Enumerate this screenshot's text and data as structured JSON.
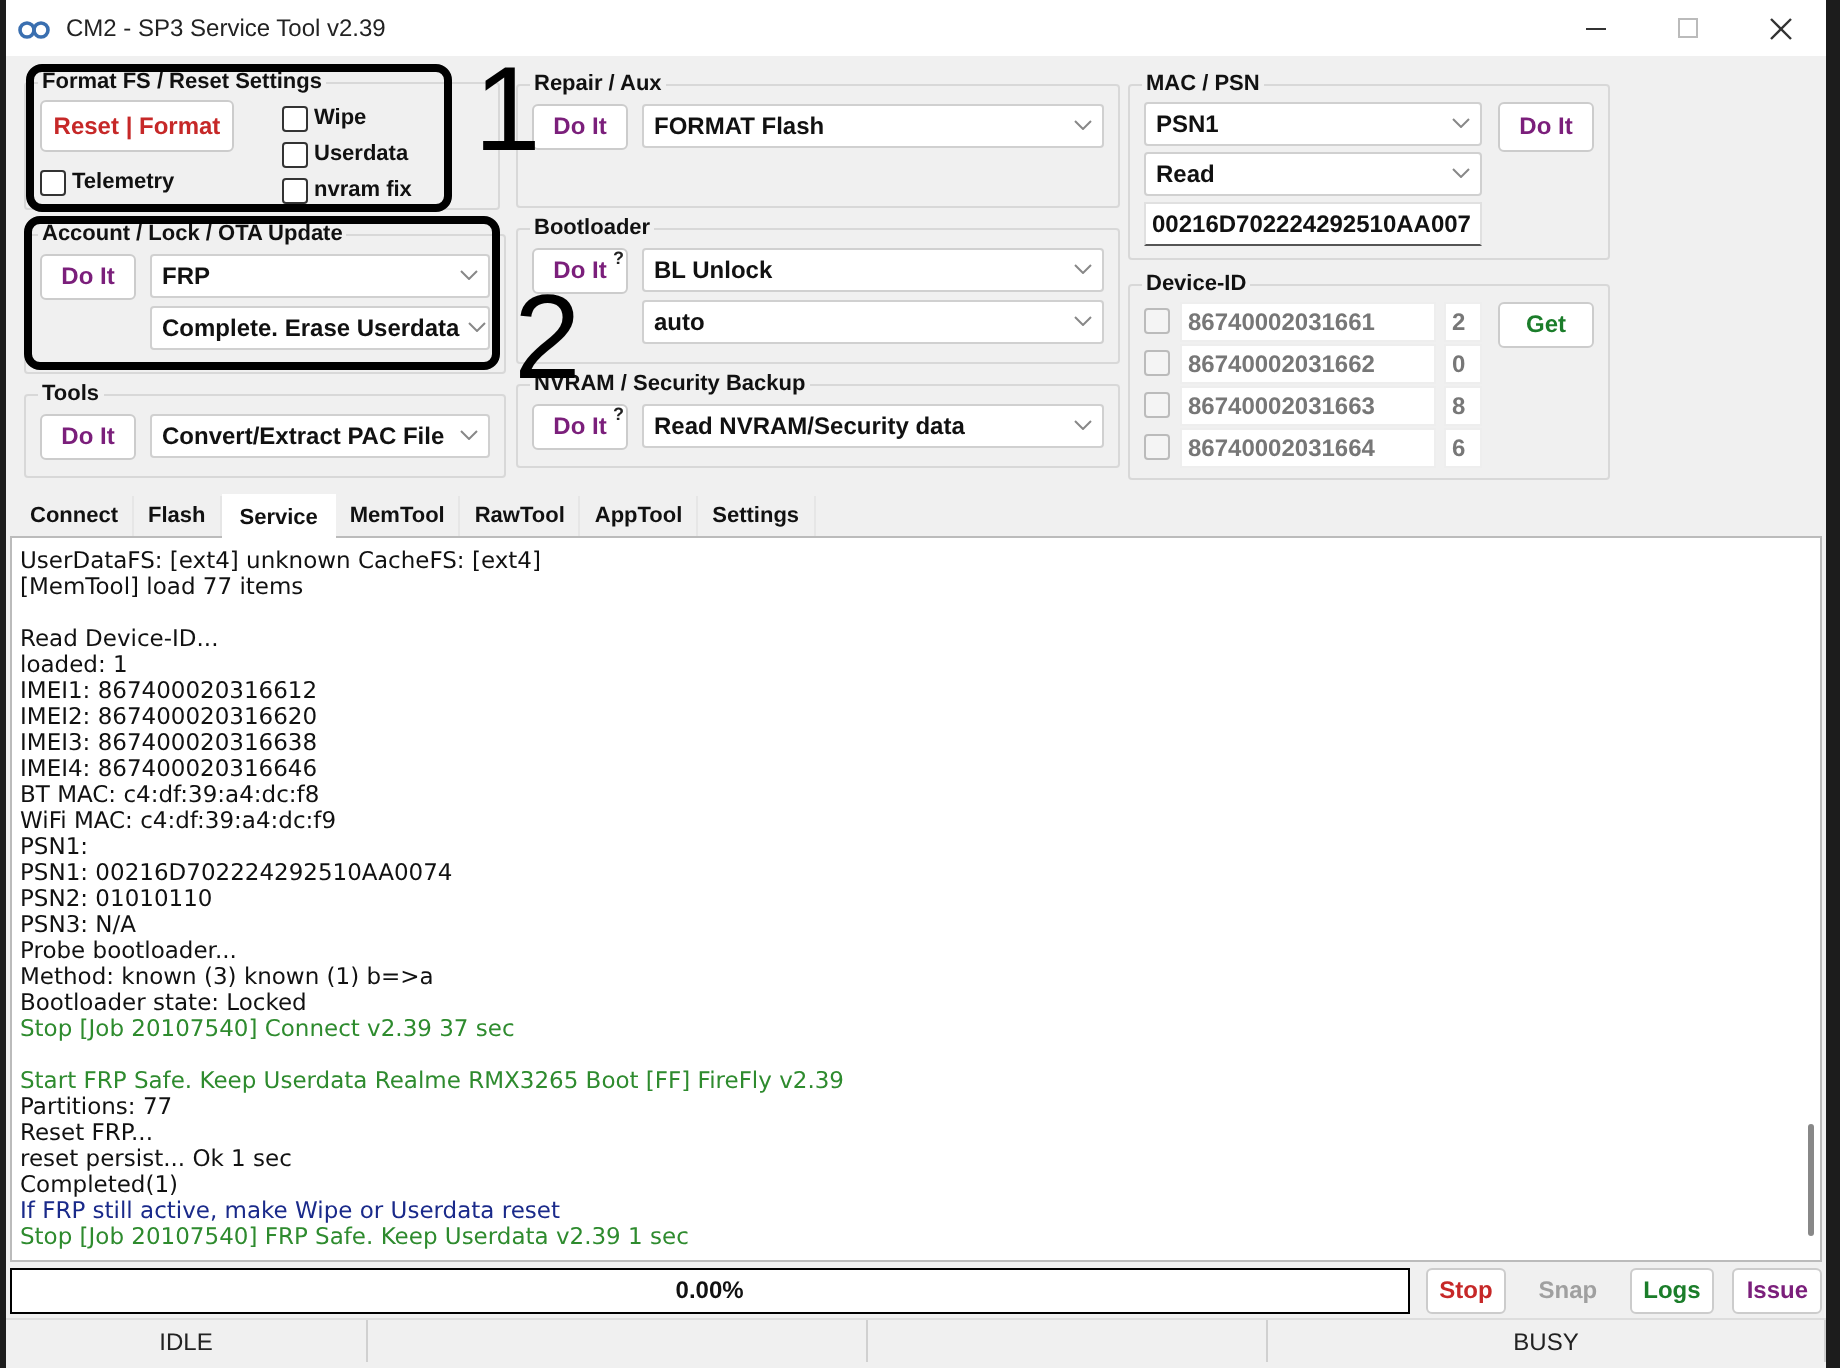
{
  "window": {
    "title": "CM2 - SP3 Service Tool v2.39"
  },
  "format_fs": {
    "title": "Format FS / Reset Settings",
    "button": "Reset | Format",
    "options": [
      {
        "label": "Wipe",
        "checked": false
      },
      {
        "label": "Userdata",
        "checked": false
      },
      {
        "label": "nvram fix",
        "checked": false
      }
    ],
    "telemetry": {
      "label": "Telemetry",
      "checked": false
    }
  },
  "account": {
    "title": "Account / Lock / OTA Update",
    "button": {
      "label": "Do It"
    },
    "selects": [
      "FRP",
      "Complete. Erase Userdata"
    ]
  },
  "tools": {
    "title": "Tools",
    "button": {
      "label": "Do It"
    },
    "selects": [
      "Convert/Extract PAC File"
    ]
  },
  "repair": {
    "title": "Repair / Aux",
    "button": {
      "label": "Do It"
    },
    "selects": [
      "FORMAT Flash"
    ]
  },
  "bootloader": {
    "title": "Bootloader",
    "button": {
      "label": "Do It",
      "hint": "?"
    },
    "selects": [
      "BL Unlock",
      "auto"
    ]
  },
  "nvram": {
    "title": "NVRAM / Security Backup",
    "button": {
      "label": "Do It",
      "hint": "?"
    },
    "selects": [
      "Read NVRAM/Security data"
    ]
  },
  "mac_psn": {
    "title": "MAC / PSN",
    "selects": [
      "PSN1",
      "Read"
    ],
    "button": "Do It",
    "value": "00216D702224292510AA007"
  },
  "device_id": {
    "title": "Device-ID",
    "button": "Get",
    "rows": [
      {
        "checked": false,
        "id": "86740002031661",
        "digit": "2"
      },
      {
        "checked": false,
        "id": "86740002031662",
        "digit": "0"
      },
      {
        "checked": false,
        "id": "86740002031663",
        "digit": "8"
      },
      {
        "checked": false,
        "id": "86740002031664",
        "digit": "6"
      }
    ]
  },
  "tabs": [
    {
      "label": "Connect",
      "selected": false
    },
    {
      "label": "Flash",
      "selected": false
    },
    {
      "label": "Service",
      "selected": true
    },
    {
      "label": "MemTool",
      "selected": false
    },
    {
      "label": "RawTool",
      "selected": false
    },
    {
      "label": "AppTool",
      "selected": false
    },
    {
      "label": "Settings",
      "selected": false
    }
  ],
  "log": [
    {
      "text": "UserDataFS: [ext4] unknown CacheFS: [ext4]",
      "kind": "info"
    },
    {
      "text": "[MemTool] load 77 items",
      "kind": "info"
    },
    {
      "text": "Read Device-ID...",
      "kind": "info",
      "gap_before": true
    },
    {
      "text": "loaded: 1",
      "kind": "info"
    },
    {
      "text": "IMEI1: 867400020316612",
      "kind": "info"
    },
    {
      "text": "IMEI2: 867400020316620",
      "kind": "info"
    },
    {
      "text": "IMEI3: 867400020316638",
      "kind": "info"
    },
    {
      "text": "IMEI4: 867400020316646",
      "kind": "info"
    },
    {
      "text": "BT MAC: c4:df:39:a4:dc:f8",
      "kind": "info"
    },
    {
      "text": "WiFi MAC: c4:df:39:a4:dc:f9",
      "kind": "info"
    },
    {
      "text": "PSN1:",
      "kind": "info"
    },
    {
      "text": "PSN1: 00216D702224292510AA0074",
      "kind": "info"
    },
    {
      "text": "PSN2: 01010110",
      "kind": "info"
    },
    {
      "text": "PSN3: N/A",
      "kind": "info"
    },
    {
      "text": "Probe bootloader...",
      "kind": "info"
    },
    {
      "text": "Method: known (3) known (1) b=>a",
      "kind": "info"
    },
    {
      "text": "Bootloader state: Locked",
      "kind": "info"
    },
    {
      "text": "Stop [Job 20107540] Connect v2.39 37 sec",
      "kind": "success"
    },
    {
      "text": "Start FRP Safe. Keep Userdata Realme RMX3265 Boot [FF] FireFly v2.39",
      "kind": "success",
      "gap_before": true
    },
    {
      "text": "Partitions: 77",
      "kind": "info"
    },
    {
      "text": "Reset FRP...",
      "kind": "info"
    },
    {
      "text": "reset persist... Ok 1 sec",
      "kind": "info"
    },
    {
      "text": "Completed(1)",
      "kind": "info"
    },
    {
      "text": "If FRP still active, make Wipe or Userdata reset",
      "kind": "note"
    },
    {
      "text": "Stop [Job 20107540] FRP Safe. Keep Userdata v2.39 1 sec",
      "kind": "success"
    }
  ],
  "progress": {
    "level": 0,
    "text": "0.00%"
  },
  "actions": [
    {
      "label": "Stop",
      "color": "#c62828",
      "disabled": false
    },
    {
      "label": "Snap",
      "disabled": true
    },
    {
      "label": "Logs",
      "color": "#1b7d2a",
      "disabled": false
    },
    {
      "label": "Issue",
      "color": "#7b1f7b",
      "disabled": false
    }
  ],
  "status_bar": [
    "IDLE",
    "BUSY"
  ],
  "annotations": [
    {
      "label": "1"
    },
    {
      "label": "2"
    }
  ]
}
